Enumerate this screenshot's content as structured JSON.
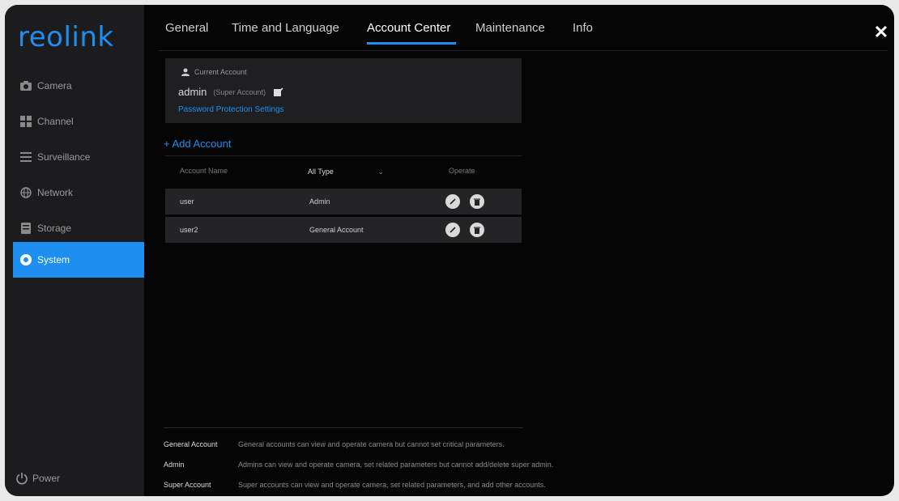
{
  "sidebar": {
    "logo": "reolink",
    "items": [
      {
        "label": "Camera",
        "icon": "camera-icon"
      },
      {
        "label": "Channel",
        "icon": "channel-grid-icon"
      },
      {
        "label": "Surveillance",
        "icon": "list-icon"
      },
      {
        "label": "Network",
        "icon": "globe-icon"
      },
      {
        "label": "Storage",
        "icon": "storage-icon"
      },
      {
        "label": "System",
        "icon": "gear-icon",
        "active": true
      }
    ],
    "power_label": "Power"
  },
  "tabs": [
    {
      "label": "General"
    },
    {
      "label": "Time and Language"
    },
    {
      "label": "Account Center",
      "active": true
    },
    {
      "label": "Maintenance"
    },
    {
      "label": "Info"
    }
  ],
  "account_card": {
    "title": "Current Account",
    "username": "admin",
    "type": "(Super Account)",
    "password_link": "Password Protection Settings"
  },
  "add_account_label": "+ Add Account",
  "list": {
    "col_name": "Account Name",
    "type_filter": "All Type",
    "col_ops": "Operate",
    "rows": [
      {
        "name": "user",
        "type": "Admin"
      },
      {
        "name": "user2",
        "type": "General Account"
      }
    ]
  },
  "legend": [
    {
      "label": "General Account",
      "desc": "General accounts can view and operate camera but cannot set critical parameters."
    },
    {
      "label": "Admin",
      "desc": "Admins can view and operate camera, set related parameters but cannot add/delete super admin."
    },
    {
      "label": "Super Account",
      "desc": "Super accounts can view and operate camera, set related parameters, and add other accounts."
    }
  ],
  "colors": {
    "accent": "#1e8ff0",
    "background": "#050505",
    "sidebar": "#1c1c1e"
  }
}
